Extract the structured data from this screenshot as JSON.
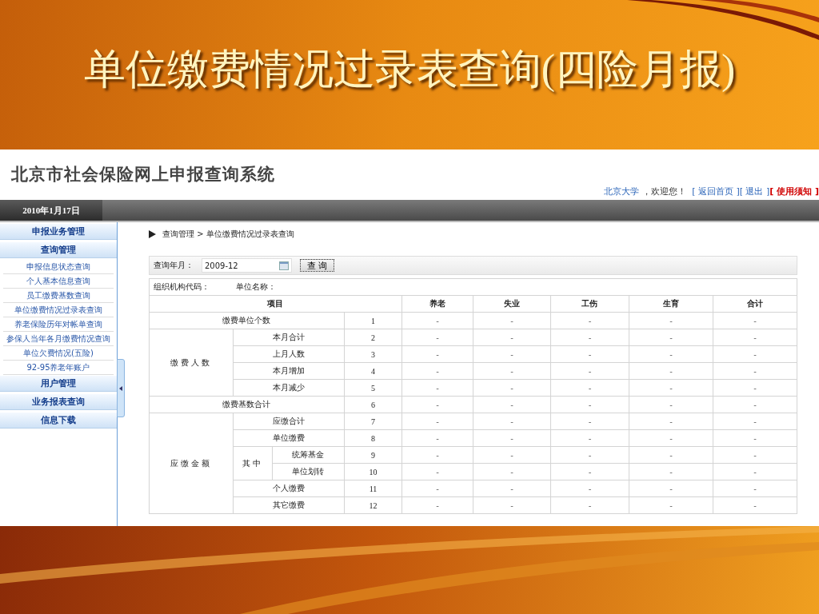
{
  "slide": {
    "title": "单位缴费情况过录表查询(四险月报)"
  },
  "app": {
    "logo": "北京市社会保险网上申报查询系统",
    "user": "北京大学",
    "welcome": "，欢迎您！",
    "links": [
      {
        "label": "[ 返回首页 ]",
        "kind": "normal"
      },
      {
        "label": "[ 退出 ]",
        "kind": "normal"
      },
      {
        "label": "[ 使用须知 ]",
        "kind": "notice"
      }
    ],
    "date": "2010年1月17日"
  },
  "sidebar": {
    "sections": [
      {
        "label": "申报业务管理"
      },
      {
        "label": "查询管理",
        "items": [
          "申报信息状态查询",
          "个人基本信息查询",
          "员工缴费基数查询",
          "单位缴费情况过录表查询",
          "养老保险历年对帐单查询",
          "参保人当年各月缴费情况查询",
          "单位欠费情况(五险)",
          "92-95养老年账户"
        ]
      },
      {
        "label": "用户管理"
      },
      {
        "label": "业务报表查询"
      },
      {
        "label": "信息下载"
      }
    ]
  },
  "breadcrumb": "查询管理 > 单位缴费情况过录表查询",
  "query": {
    "label": "查询年月：",
    "value": "2009-12",
    "button": "查 询"
  },
  "info": [
    "组织机构代码：",
    "单位名称："
  ],
  "table": {
    "columns": [
      "项目",
      "养老",
      "失业",
      "工伤",
      "生育",
      "合计"
    ],
    "rows": [
      {
        "kind": "item",
        "label": "缴费单位个数",
        "no": "1",
        "values": [
          "-",
          "-",
          "-",
          "-",
          "-"
        ]
      },
      {
        "kind": "group",
        "label": "缴费人数",
        "children": [
          {
            "kind": "item",
            "label": "本月合计",
            "no": "2",
            "values": [
              "-",
              "-",
              "-",
              "-",
              "-"
            ]
          },
          {
            "kind": "item",
            "label": "上月人数",
            "no": "3",
            "values": [
              "-",
              "-",
              "-",
              "-",
              "-"
            ]
          },
          {
            "kind": "item",
            "label": "本月增加",
            "no": "4",
            "values": [
              "-",
              "-",
              "-",
              "-",
              "-"
            ]
          },
          {
            "kind": "item",
            "label": "本月减少",
            "no": "5",
            "values": [
              "-",
              "-",
              "-",
              "-",
              "-"
            ]
          }
        ]
      },
      {
        "kind": "item",
        "label": "缴费基数合计",
        "no": "6",
        "values": [
          "-",
          "-",
          "-",
          "-",
          "-"
        ]
      },
      {
        "kind": "group",
        "label": "应缴金额",
        "children": [
          {
            "kind": "item",
            "label": "应缴合计",
            "no": "7",
            "values": [
              "-",
              "-",
              "-",
              "-",
              "-"
            ]
          },
          {
            "kind": "item",
            "label": "单位缴费",
            "no": "8",
            "values": [
              "-",
              "-",
              "-",
              "-",
              "-"
            ]
          },
          {
            "kind": "group",
            "label": "其中",
            "children": [
              {
                "kind": "item",
                "label": "统筹基金",
                "no": "9",
                "values": [
                  "-",
                  "-",
                  "-",
                  "-",
                  "-"
                ]
              },
              {
                "kind": "item",
                "label": "单位划转",
                "no": "10",
                "values": [
                  "-",
                  "-",
                  "-",
                  "-",
                  "-"
                ]
              }
            ]
          },
          {
            "kind": "item",
            "label": "个人缴费",
            "no": "11",
            "values": [
              "-",
              "-",
              "-",
              "-",
              "-"
            ]
          },
          {
            "kind": "item",
            "label": "其它缴费",
            "no": "12",
            "values": [
              "-",
              "-",
              "-",
              "-",
              "-"
            ]
          }
        ]
      }
    ]
  }
}
